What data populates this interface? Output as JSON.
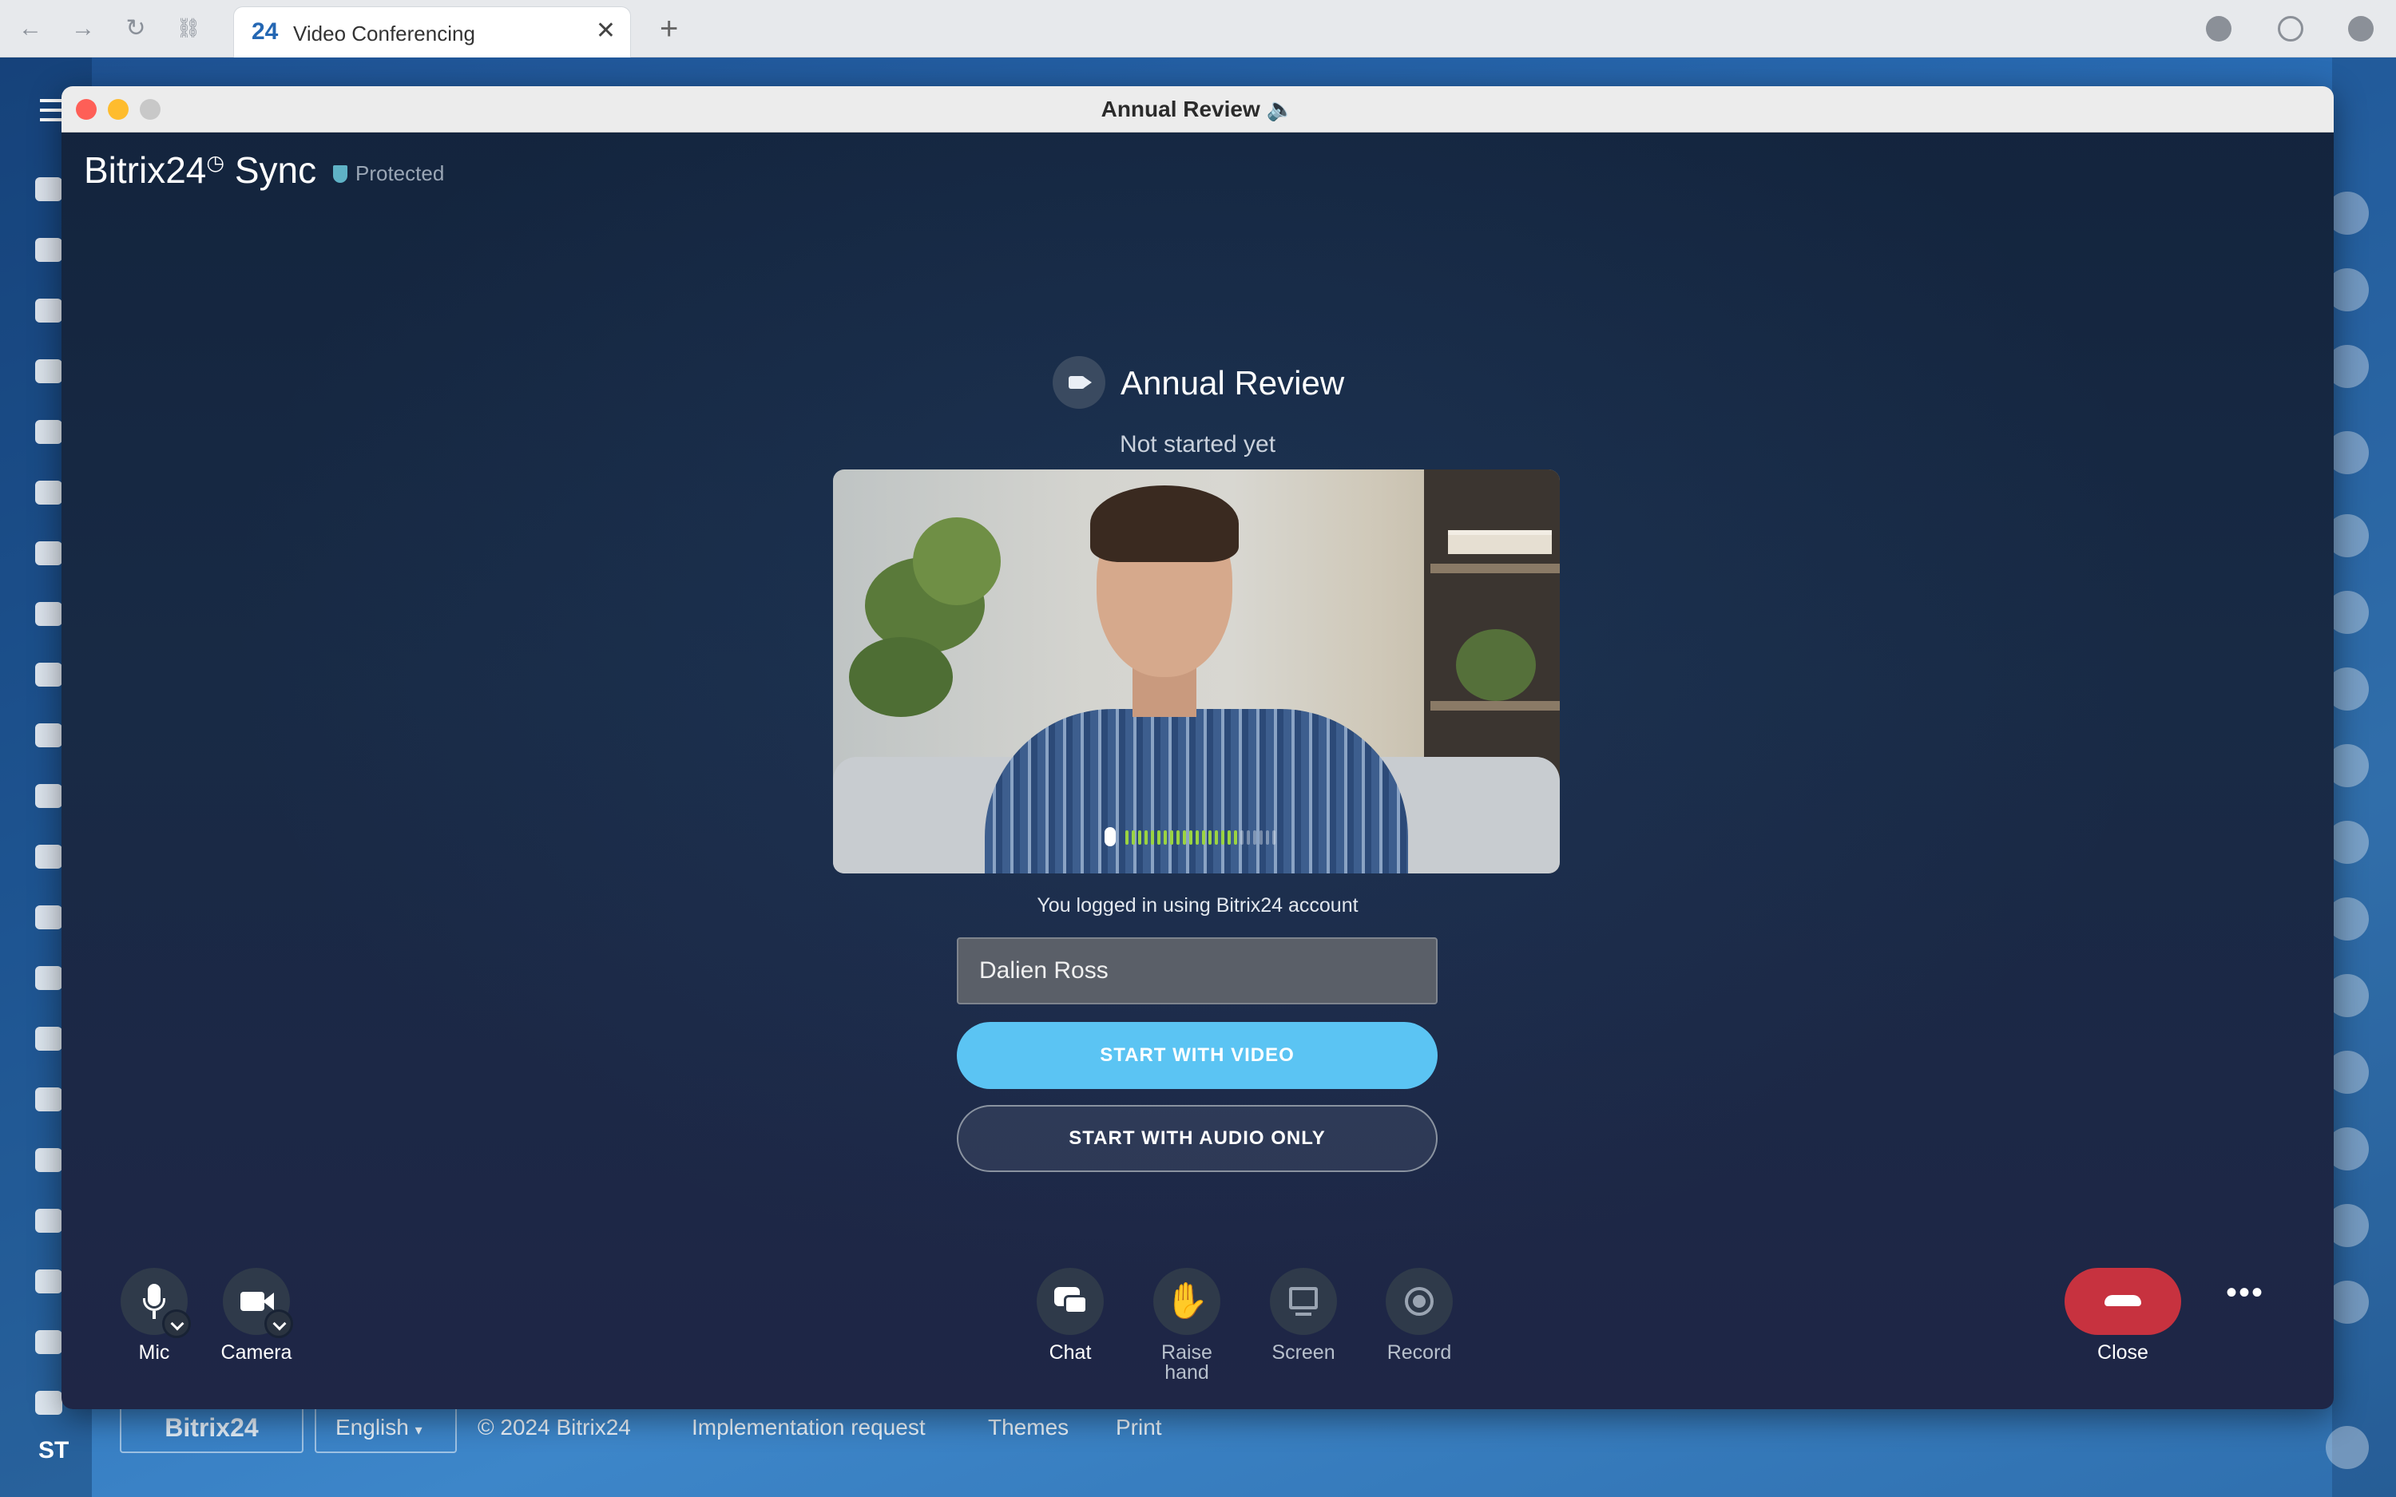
{
  "browser": {
    "tab_icon": "24",
    "tab_title": "Video Conferencing",
    "tab_close": "✕",
    "new_tab": "+",
    "back": "←",
    "forward": "→",
    "reload": "↻",
    "link": "⛓"
  },
  "bitrix": {
    "user_initials": "ST",
    "footer": {
      "logo": "Bitrix24",
      "language": "English",
      "copyright": "© 2024 Bitrix24",
      "links": [
        "Implementation request",
        "Themes",
        "Print"
      ]
    }
  },
  "call": {
    "window_title": "Annual Review 🔈",
    "brand": "Bitrix24",
    "brand_suffix": "Sync",
    "protected_label": "Protected",
    "meeting_title": "Annual Review",
    "meeting_status": "Not started yet",
    "mic_level": 0.75,
    "logged_in_text": "You logged in using Bitrix24 account",
    "name_value": "Dalien Ross",
    "start_video_label": "START WITH VIDEO",
    "start_audio_label": "START WITH AUDIO ONLY",
    "controls": {
      "mic": "Mic",
      "camera": "Camera",
      "chat": "Chat",
      "raise_hand_line1": "Raise",
      "raise_hand_line2": "hand",
      "screen": "Screen",
      "record": "Record",
      "close": "Close",
      "more": "•••"
    }
  },
  "colors": {
    "accent_button": "#5bc4f3",
    "close_button": "#c7323f",
    "call_background": "#182a45"
  }
}
